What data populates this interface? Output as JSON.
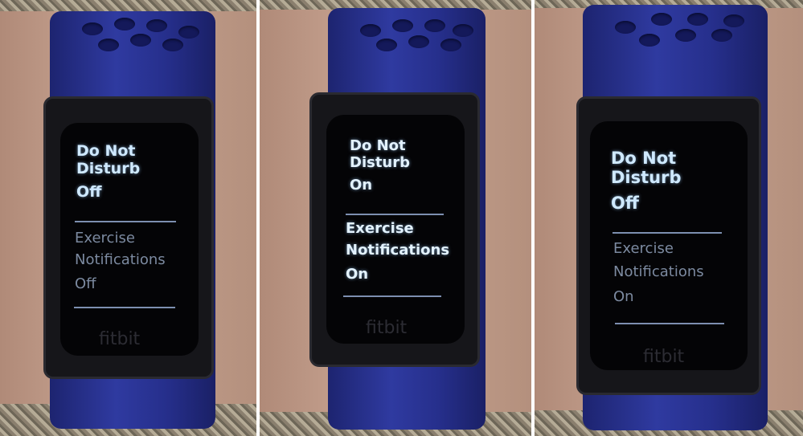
{
  "panels": [
    {
      "dnd_title_1": "Do Not",
      "dnd_title_2": "Disturb",
      "dnd_state": "Off",
      "ex_title_1": "Exercise",
      "ex_title_2": "Notifications",
      "ex_state": "Off",
      "logo": "fitbit"
    },
    {
      "dnd_title_1": "Do Not",
      "dnd_title_2": "Disturb",
      "dnd_state": "On",
      "ex_title_1": "Exercise",
      "ex_title_2": "Notifications",
      "ex_state": "On",
      "logo": "fitbit"
    },
    {
      "dnd_title_1": "Do Not",
      "dnd_title_2": "Disturb",
      "dnd_state": "Off",
      "ex_title_1": "Exercise",
      "ex_title_2": "Notifications",
      "ex_state": "On",
      "logo": "fitbit"
    }
  ],
  "colors": {
    "band": "#2f3aa0",
    "screen_text": "#cfe9ff",
    "dim_text": "#7c8aa0"
  }
}
